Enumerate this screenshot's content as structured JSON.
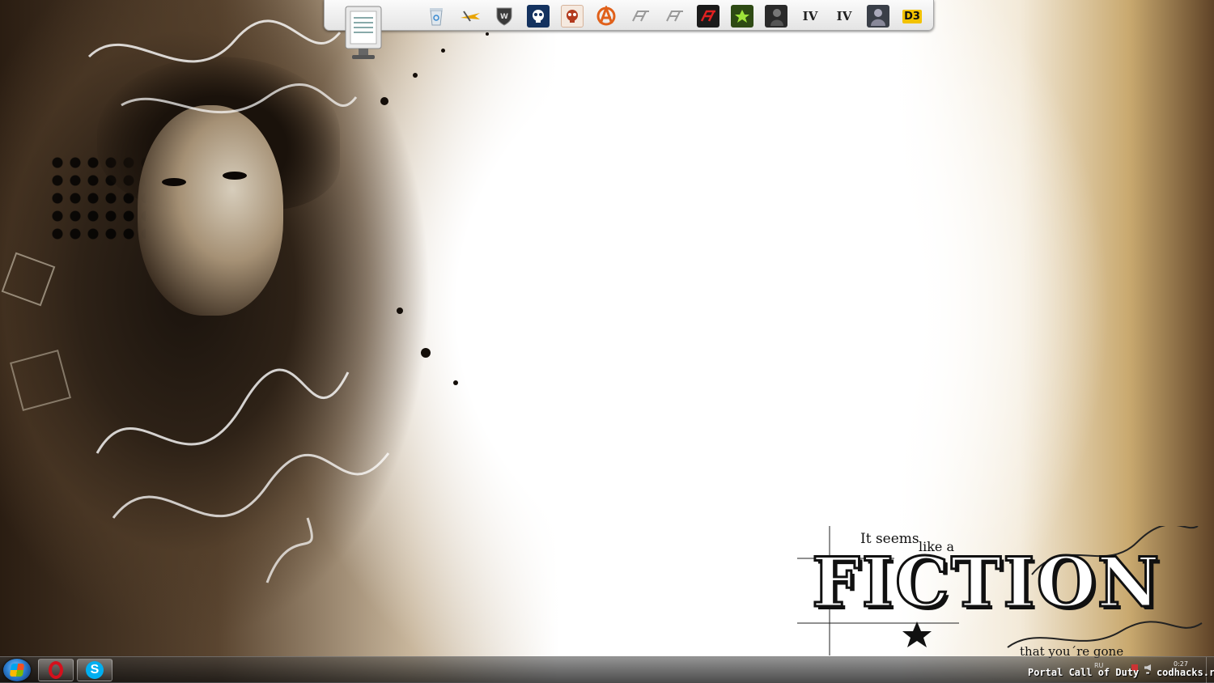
{
  "wallpaper": {
    "text_top": "It seems",
    "text_like": "like a",
    "text_title": "FICTION",
    "text_bottom": "that you´re gone"
  },
  "dock": {
    "items": [
      {
        "name": "notepad",
        "label": ""
      },
      {
        "name": "recycle-bin",
        "label": ""
      },
      {
        "name": "aircraft-game",
        "label": ""
      },
      {
        "name": "world-of-tanks",
        "label": ""
      },
      {
        "name": "black-ops",
        "label": ""
      },
      {
        "name": "black-ops-zombies",
        "label": ""
      },
      {
        "name": "anarchy",
        "label": ""
      },
      {
        "name": "nfs-1",
        "label": ""
      },
      {
        "name": "nfs-2",
        "label": ""
      },
      {
        "name": "nfs-3",
        "label": ""
      },
      {
        "name": "green-game",
        "label": ""
      },
      {
        "name": "soldier-game",
        "label": ""
      },
      {
        "name": "gta-iv-1",
        "label": "IV"
      },
      {
        "name": "gta-iv-2",
        "label": "IV"
      },
      {
        "name": "warrior-game",
        "label": ""
      },
      {
        "name": "diablo-3",
        "label": "D3"
      }
    ]
  },
  "taskbar": {
    "tray_lang": "RU",
    "tray_time": "0:27"
  },
  "watermark": "Portal Call of Duty - codhacks.ru",
  "colors": {
    "opera": "#d4101c",
    "skype": "#00aff0"
  }
}
